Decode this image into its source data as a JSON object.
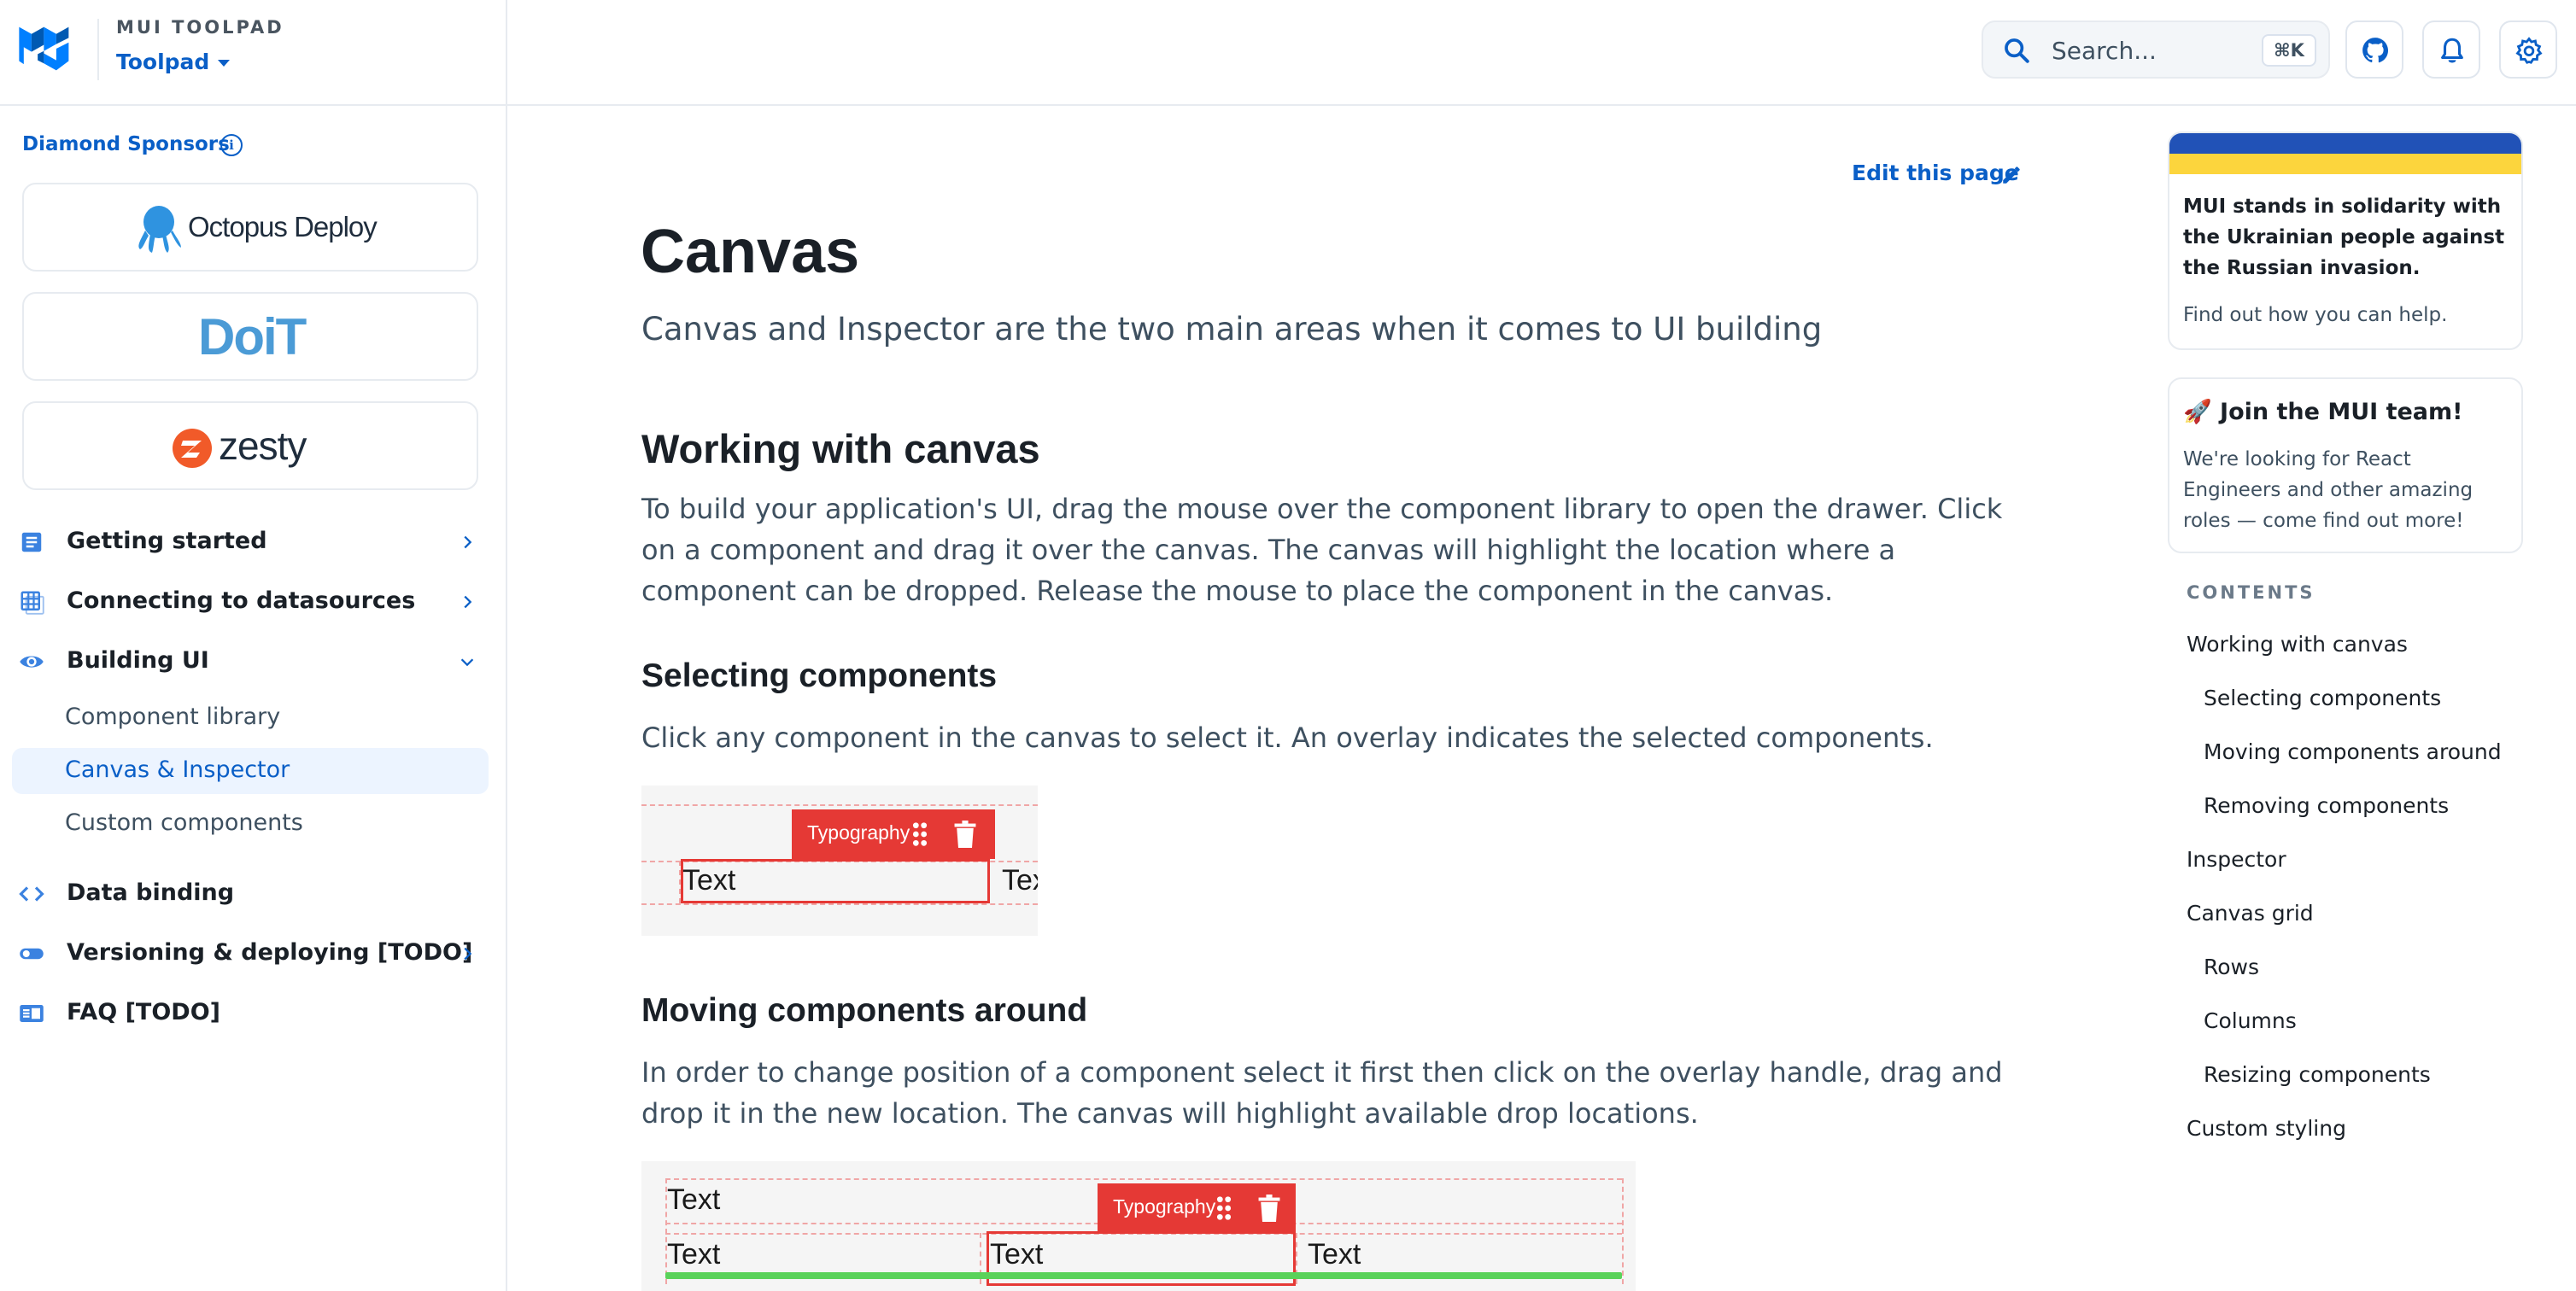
{
  "header": {
    "brand": "MUI TOOLPAD",
    "product": "Toolpad",
    "search_placeholder": "Search...",
    "search_shortcut": "⌘K",
    "icons": [
      "search-icon",
      "github-icon",
      "bell-icon",
      "gear-icon"
    ],
    "accent_color": "#0a5fc7"
  },
  "sidebar": {
    "sponsors_label": "Diamond Sponsors",
    "sponsors": [
      {
        "name": "Octopus Deploy"
      },
      {
        "name": "DoiT"
      },
      {
        "name": "zesty"
      }
    ],
    "nav": [
      {
        "label": "Getting started",
        "icon": "document-icon",
        "expanded": false
      },
      {
        "label": "Connecting to datasources",
        "icon": "table-icon",
        "expanded": false
      },
      {
        "label": "Building UI",
        "icon": "eye-icon",
        "expanded": true
      },
      {
        "label": "Data binding",
        "icon": "code-icon",
        "expanded": false
      },
      {
        "label": "Versioning & deploying [TODO]",
        "icon": "toggle-icon",
        "expanded": false
      },
      {
        "label": "FAQ [TODO]",
        "icon": "chrome-reader-icon",
        "expanded": false
      }
    ],
    "building_ui_items": [
      {
        "label": "Component library",
        "active": false
      },
      {
        "label": "Canvas & Inspector",
        "active": true
      },
      {
        "label": "Custom components",
        "active": false
      }
    ]
  },
  "main": {
    "edit_link": "Edit this page",
    "title": "Canvas",
    "subtitle": "Canvas and Inspector are the two main areas when it comes to UI building",
    "sections": {
      "working_heading": "Working with canvas",
      "working_text": "To build your application's UI, drag the mouse over the component library to open the drawer. Click on a component and drag it over the canvas. The canvas will highlight the location where a component can be dropped. Release the mouse to place the component in the canvas.",
      "selecting_heading": "Selecting components",
      "selecting_text": "Click any component in the canvas to select it. An overlay indicates the selected components.",
      "moving_heading": "Moving components around",
      "moving_text": "In order to change position of a component select it first then click on the overlay handle, drag and drop it in the new location. The canvas will highlight available drop locations."
    },
    "demo1": {
      "overlay_label": "Typography",
      "text_selected": "Text",
      "text_clipped": "Tex"
    },
    "demo2": {
      "overlay_label": "Typography",
      "text_top": "Text",
      "text_row": [
        "Text",
        "Text",
        "Text"
      ]
    }
  },
  "right": {
    "ukraine_text": "MUI stands in solidarity with the Ukrainian people against the Russian invasion.",
    "ukraine_help": "Find out how you can help.",
    "ukraine_colors": [
      "#2152b7",
      "#fcd53d"
    ],
    "job_title": "🚀 Join the MUI team!",
    "job_body": "We're looking for React Engineers and other amazing roles — come find out more!",
    "toc_heading": "CONTENTS",
    "toc": [
      {
        "label": "Working with canvas",
        "level": 1
      },
      {
        "label": "Selecting components",
        "level": 2
      },
      {
        "label": "Moving components around",
        "level": 2
      },
      {
        "label": "Removing components",
        "level": 2
      },
      {
        "label": "Inspector",
        "level": 1
      },
      {
        "label": "Canvas grid",
        "level": 1
      },
      {
        "label": "Rows",
        "level": 2
      },
      {
        "label": "Columns",
        "level": 2
      },
      {
        "label": "Resizing components",
        "level": 2
      },
      {
        "label": "Custom styling",
        "level": 1
      }
    ]
  }
}
